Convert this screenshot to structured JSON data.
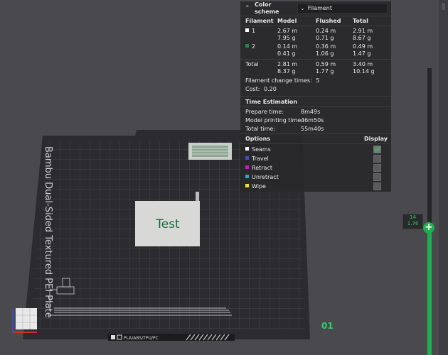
{
  "window": {
    "plate_name": "Bambu Dual-Sided Textured PEI Plate",
    "plate_materials": "PLA/ABS/TPU/PC",
    "model_label": "Test",
    "plate_number": "01"
  },
  "header": {
    "label": "Color scheme",
    "selected": "Filament"
  },
  "filament_table": {
    "columns": [
      "Filament",
      "Model",
      "Flushed",
      "Total"
    ],
    "rows": [
      {
        "id": "1",
        "color": "#ffffff",
        "model_m": "2.67 m",
        "model_g": "7.95 g",
        "flushed_m": "0.24 m",
        "flushed_g": "0.71 g",
        "total_m": "2.91 m",
        "total_g": "8.67 g"
      },
      {
        "id": "2",
        "color": "#1e8a4a",
        "model_m": "0.14 m",
        "model_g": "0.41 g",
        "flushed_m": "0.36 m",
        "flushed_g": "1.06 g",
        "total_m": "0.49 m",
        "total_g": "1.47 g"
      }
    ],
    "total": {
      "label": "Total",
      "model_m": "2.81 m",
      "model_g": "8.37 g",
      "flushed_m": "0.59 m",
      "flushed_g": "1.77 g",
      "total_m": "3.40 m",
      "total_g": "10.14 g"
    },
    "change_times_label": "Filament change times:",
    "change_times_value": "5",
    "cost_label": "Cost:",
    "cost_value": "0.20"
  },
  "time_estimation": {
    "title": "Time Estimation",
    "items": [
      {
        "label": "Prepare time:",
        "value": "8m49s"
      },
      {
        "label": "Model printing time:",
        "value": "46m50s"
      },
      {
        "label": "Total time:",
        "value": "55m40s"
      }
    ]
  },
  "options": {
    "title": "Options",
    "display_label": "Display",
    "items": [
      {
        "label": "Seams",
        "color": "#ffffff",
        "checked": true
      },
      {
        "label": "Travel",
        "color": "#3b4fc4",
        "checked": false
      },
      {
        "label": "Retract",
        "color": "#c81ac8",
        "checked": false
      },
      {
        "label": "Unretract",
        "color": "#26a6c8",
        "checked": false
      },
      {
        "label": "Wipe",
        "color": "#f2e21a",
        "checked": false
      }
    ]
  },
  "layer_slider": {
    "layer": "14",
    "height": "1.76",
    "fraction": 0.44,
    "handle_symbol": "+"
  },
  "colors": {
    "accent": "#1fae4e",
    "background": "#4a4a4e",
    "panel": "#28282a"
  },
  "icons": {
    "header_toggle": "double-chevron-up-icon",
    "dropdown": "chevron-down-icon"
  }
}
